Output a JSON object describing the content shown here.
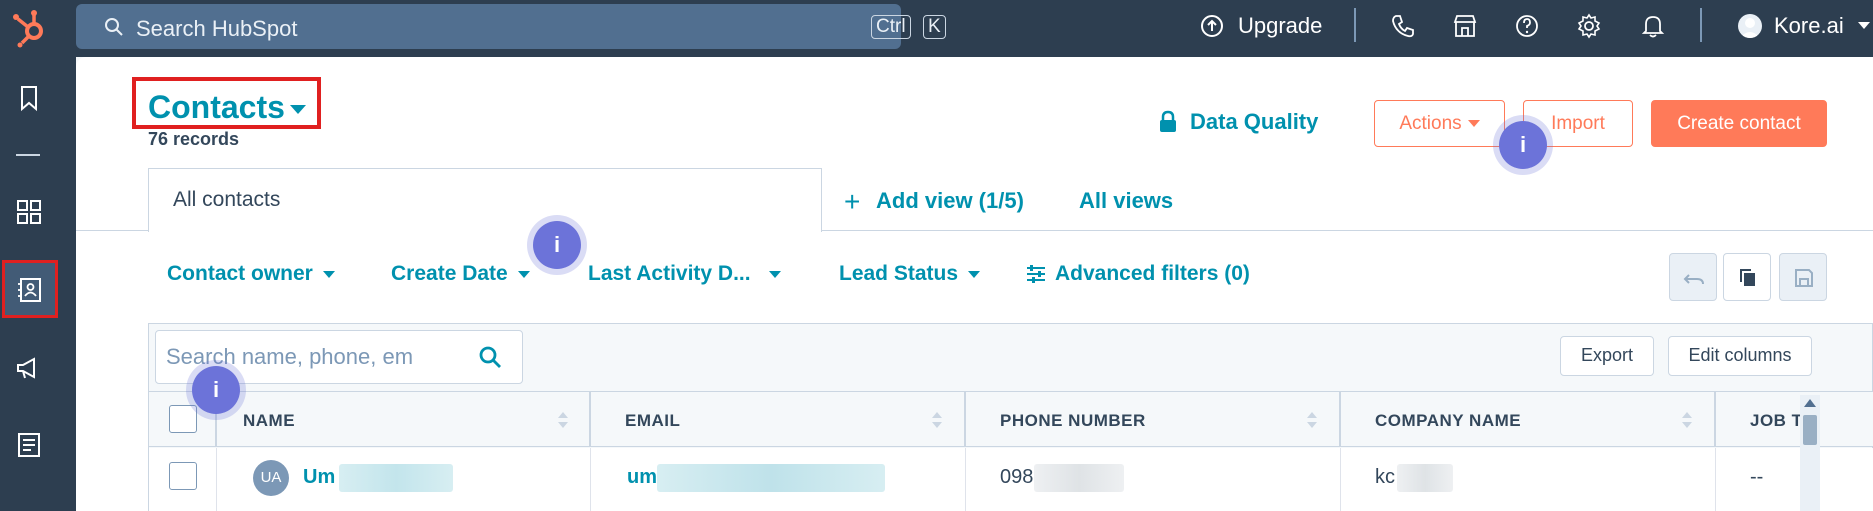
{
  "topbar": {
    "search_placeholder": "Search HubSpot",
    "shortcut_key1": "Ctrl",
    "shortcut_key2": "K",
    "upgrade_label": "Upgrade",
    "account_name": "Kore.ai"
  },
  "header": {
    "title": "Contacts",
    "record_count": "76 records",
    "data_quality_label": "Data Quality",
    "actions_label": "Actions",
    "import_label": "Import",
    "create_label": "Create contact"
  },
  "views": {
    "active_tab": "All contacts",
    "add_view_label": "Add view (1/5)",
    "all_views_label": "All views"
  },
  "filters": {
    "contact_owner": "Contact owner",
    "create_date": "Create Date",
    "last_activity": "Last Activity D...",
    "lead_status": "Lead Status",
    "advanced": "Advanced filters (0)"
  },
  "table": {
    "search_placeholder": "Search name, phone, em",
    "export_label": "Export",
    "edit_columns_label": "Edit columns",
    "columns": [
      "NAME",
      "EMAIL",
      "PHONE NUMBER",
      "COMPANY NAME",
      "JOB T"
    ],
    "rows": [
      {
        "initials": "UA",
        "name": "Um",
        "email": "um",
        "phone": "098",
        "company": "kc",
        "job": "--"
      }
    ]
  },
  "badges": {
    "info": "i"
  },
  "colors": {
    "brand_orange": "#ff7a59",
    "link_teal": "#0091ae",
    "nav_dark": "#2d3e50",
    "highlight_red": "#e02020",
    "badge_purple": "#6c73d9"
  }
}
